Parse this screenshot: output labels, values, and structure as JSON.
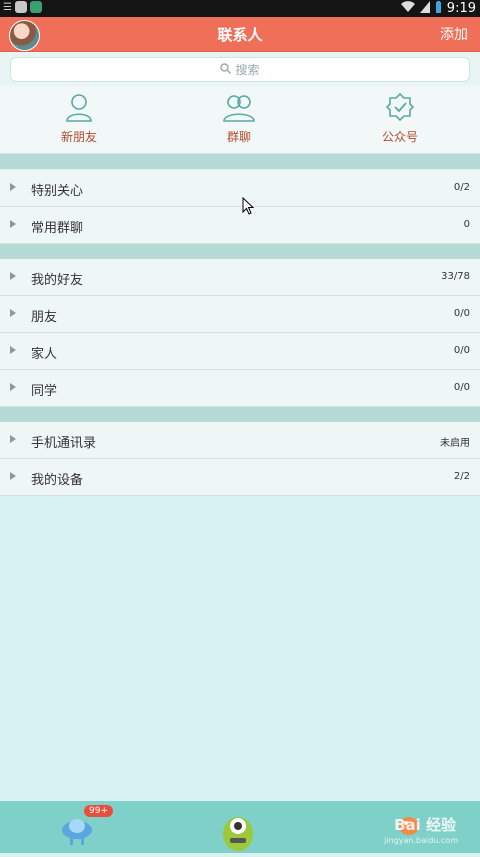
{
  "status_bar": {
    "time": "9:19"
  },
  "header": {
    "title": "联系人",
    "add_label": "添加"
  },
  "search": {
    "placeholder": "搜索"
  },
  "quick_actions": [
    {
      "label": "新朋友",
      "icon": "person-icon"
    },
    {
      "label": "群聊",
      "icon": "group-icon"
    },
    {
      "label": "公众号",
      "icon": "verified-badge-icon"
    }
  ],
  "groups": [
    {
      "label": "特别关心",
      "count": "0/2"
    },
    {
      "label": "常用群聊",
      "count": "0"
    },
    {
      "label": "我的好友",
      "count": "33/78"
    },
    {
      "label": "朋友",
      "count": "0/0"
    },
    {
      "label": "家人",
      "count": "0/0"
    },
    {
      "label": "同学",
      "count": "0/0"
    },
    {
      "label": "手机通讯录",
      "count": "未启用"
    },
    {
      "label": "我的设备",
      "count": "2/2"
    }
  ],
  "bottom_bar": {
    "badge": "99+",
    "watermark": "Bai 经验",
    "watermark_sub": "jingyan.baidu.com"
  },
  "colors": {
    "header": "#ef6f58",
    "accent_text": "#b34a2c",
    "background": "#d8f1f1",
    "bottom_bar": "#7fd0c8"
  }
}
